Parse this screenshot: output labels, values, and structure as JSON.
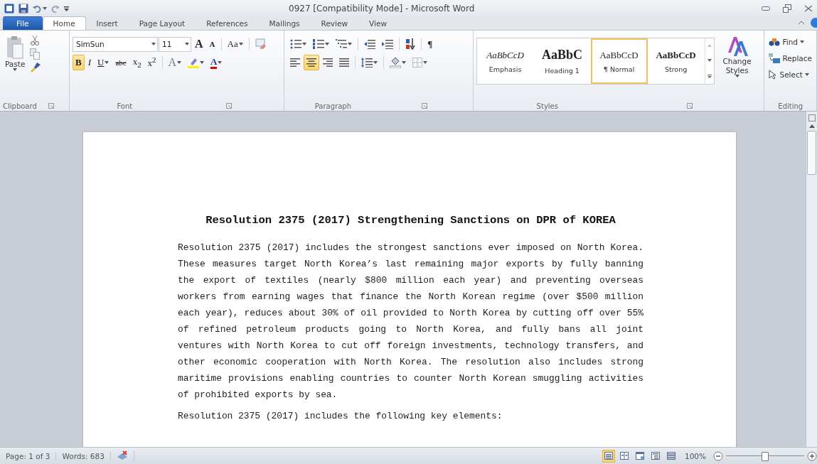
{
  "window": {
    "title": "0927 [Compatibility Mode] - Microsoft Word"
  },
  "quick_access": [
    {
      "kind": "app"
    },
    {
      "kind": "save"
    },
    {
      "kind": "undo",
      "dropdown": true
    },
    {
      "kind": "redo"
    },
    {
      "kind": "customize"
    }
  ],
  "window_controls": [
    {
      "kind": "minimize"
    },
    {
      "kind": "restore"
    },
    {
      "kind": "close"
    }
  ],
  "tabs": [
    {
      "label": "File",
      "kind": "file",
      "selected": false
    },
    {
      "label": "Home",
      "kind": "tab",
      "selected": true
    },
    {
      "label": "Insert",
      "kind": "tab",
      "selected": false
    },
    {
      "label": "Page Layout",
      "kind": "tab",
      "selected": false
    },
    {
      "label": "References",
      "kind": "tab",
      "selected": false
    },
    {
      "label": "Mailings",
      "kind": "tab",
      "selected": false
    },
    {
      "label": "Review",
      "kind": "tab",
      "selected": false
    },
    {
      "label": "View",
      "kind": "tab",
      "selected": false
    }
  ],
  "clipboard": {
    "label": "Clipboard",
    "paste": "Paste"
  },
  "font": {
    "label": "Font",
    "font_name": "SimSun",
    "font_size": "11",
    "row1": [
      {
        "kind": "grow",
        "label": "A",
        "selected": false
      },
      {
        "kind": "shrink",
        "label": "A",
        "selected": false
      },
      {
        "kind": "case",
        "label": "Aa",
        "dropdown": true,
        "selected": false
      },
      {
        "kind": "clear",
        "selected": false
      }
    ],
    "row2": [
      {
        "kind": "bold",
        "label": "B",
        "selected": true
      },
      {
        "kind": "italic",
        "label": "I",
        "selected": false
      },
      {
        "kind": "underline",
        "label": "U",
        "dropdown": true,
        "selected": false
      },
      {
        "kind": "strike",
        "label": "abc",
        "selected": false
      },
      {
        "kind": "sub",
        "label": "x$_{2}$",
        "selected": false
      },
      {
        "kind": "sup",
        "label": "x$^{2}$",
        "selected": false
      },
      {
        "kind": "effects",
        "label": "A",
        "dropdown": true,
        "selected": false
      },
      {
        "kind": "highlight",
        "dropdown": true,
        "selected": false
      },
      {
        "kind": "color",
        "label": "A",
        "dropdown": true,
        "selected": false
      }
    ]
  },
  "paragraph": {
    "label": "Paragraph",
    "row1": [
      {
        "kind": "bullets",
        "dropdown": true,
        "selected": false
      },
      {
        "kind": "numbering",
        "dropdown": true,
        "selected": false
      },
      {
        "kind": "multilevel",
        "dropdown": true,
        "selected": false
      },
      {
        "kind": "outdent",
        "selected": false
      },
      {
        "kind": "indent",
        "selected": false
      },
      {
        "kind": "sort",
        "selected": false
      },
      {
        "kind": "pilcrow",
        "label": "¶",
        "selected": false
      }
    ],
    "row2": [
      {
        "kind": "left",
        "selected": false
      },
      {
        "kind": "center",
        "selected": true
      },
      {
        "kind": "right",
        "selected": false
      },
      {
        "kind": "justify",
        "selected": false
      },
      {
        "kind": "spacing",
        "dropdown": true,
        "selected": false
      },
      {
        "kind": "shading",
        "dropdown": true,
        "selected": false
      },
      {
        "kind": "borders",
        "dropdown": true,
        "selected": false
      }
    ]
  },
  "styles": {
    "label": "Styles",
    "change_styles": "Change Styles",
    "gallery": [
      {
        "kind": "emphasis",
        "preview": "AaBbCcD",
        "name": "Emphasis",
        "selected": false
      },
      {
        "kind": "heading",
        "preview": "AaBbC",
        "name": "Heading 1",
        "selected": false
      },
      {
        "kind": "normal",
        "preview": "AaBbCcD",
        "name": "¶ Normal",
        "selected": true
      },
      {
        "kind": "strong",
        "preview": "AaBbCcD",
        "name": "Strong",
        "selected": false
      }
    ]
  },
  "editing": {
    "label": "Editing",
    "items": [
      {
        "kind": "find",
        "label": "Find",
        "dropdown": true
      },
      {
        "kind": "replace",
        "label": "Replace",
        "dropdown": false
      },
      {
        "kind": "select",
        "label": "Select",
        "dropdown": true
      }
    ]
  },
  "document": {
    "title": "Resolution 2375 (2017) Strengthening Sanctions on DPR of KOREA",
    "paragraphs": [
      "Resolution 2375 (2017) includes the strongest sanctions ever imposed on North Korea. These measures target North Korea’s last remaining major exports by fully banning the export of textiles (nearly $800 million each year) and preventing overseas workers from earning wages that finance the North Korean regime (over $500 million each year), reduces about 30% of oil provided to North Korea by cutting off over 55% of refined petroleum products going to North Korea, and fully bans all joint ventures with North Korea to cut off foreign investments, technology transfers, and other economic cooperation with North Korea. The resolution also includes strong maritime provisions enabling countries to counter North Korean smuggling activities of prohibited exports by sea.",
      "Resolution 2375 (2017) includes the following key elements:"
    ]
  },
  "status_bar": {
    "page": "Page: 1 of 3",
    "words": "Words: 683",
    "views": [
      {
        "kind": "print",
        "selected": true
      },
      {
        "kind": "reading",
        "selected": false
      },
      {
        "kind": "web",
        "selected": false
      },
      {
        "kind": "outline",
        "selected": false
      },
      {
        "kind": "draft",
        "selected": false
      }
    ],
    "zoom": "100%",
    "zoom_slider": {
      "level": 0.5
    }
  }
}
